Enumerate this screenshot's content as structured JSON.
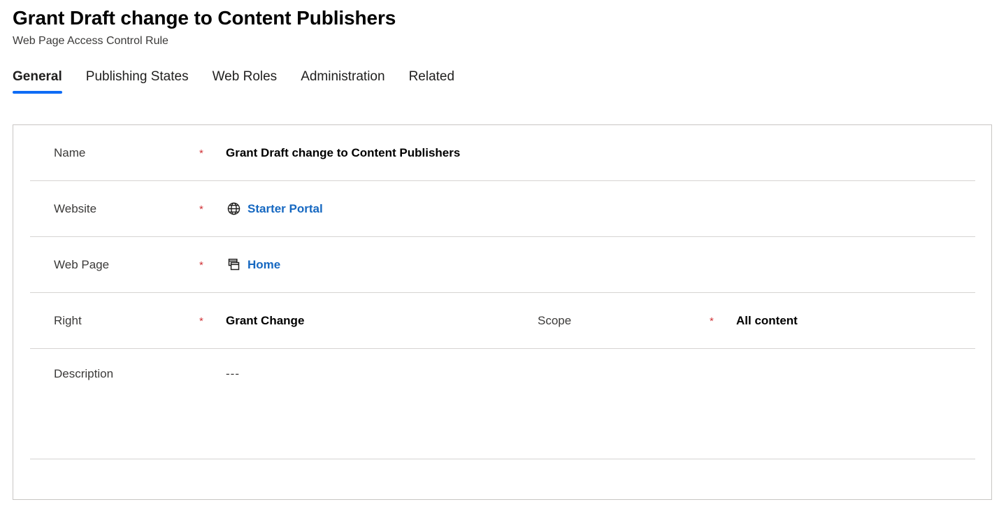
{
  "header": {
    "title": "Grant Draft change to Content Publishers",
    "subtitle": "Web Page Access Control Rule"
  },
  "tabs": [
    {
      "label": "General",
      "active": true
    },
    {
      "label": "Publishing States",
      "active": false
    },
    {
      "label": "Web Roles",
      "active": false
    },
    {
      "label": "Administration",
      "active": false
    },
    {
      "label": "Related",
      "active": false
    }
  ],
  "required_marker": "*",
  "form": {
    "name": {
      "label": "Name",
      "value": "Grant Draft change to Content Publishers"
    },
    "website": {
      "label": "Website",
      "value": "Starter Portal",
      "icon": "globe-icon"
    },
    "webpage": {
      "label": "Web Page",
      "value": "Home",
      "icon": "pages-stack-icon"
    },
    "right": {
      "label": "Right",
      "value": "Grant Change"
    },
    "scope": {
      "label": "Scope",
      "value": "All content"
    },
    "description": {
      "label": "Description",
      "value": "---"
    }
  },
  "colors": {
    "accent": "#0f6cf5",
    "link": "#1668c1",
    "required": "#d13438",
    "border": "#c8c6c4",
    "divider": "#d6d4d2"
  }
}
